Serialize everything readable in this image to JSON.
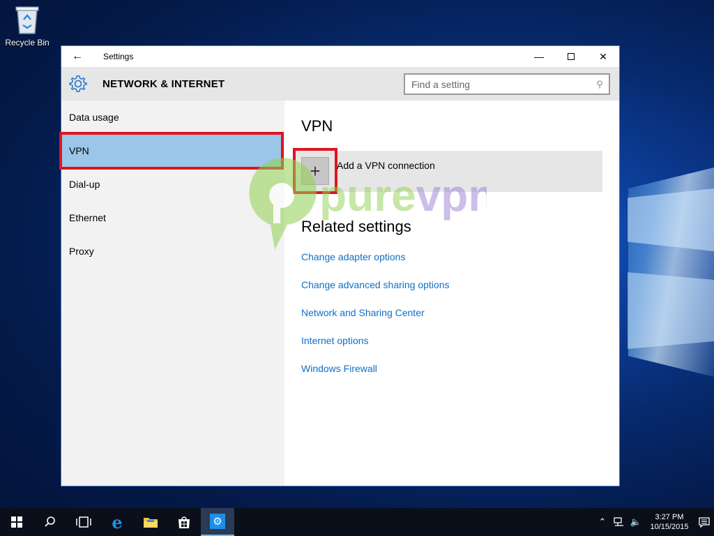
{
  "desktop": {
    "recycle_bin_label": "Recycle Bin"
  },
  "window": {
    "title": "Settings",
    "back_icon": "back-arrow-icon",
    "controls": [
      "minimize",
      "maximize",
      "close"
    ]
  },
  "header": {
    "section_title": "NETWORK & INTERNET",
    "search_placeholder": "Find a setting"
  },
  "sidebar": {
    "items": [
      {
        "label": "Data usage",
        "active": false
      },
      {
        "label": "VPN",
        "active": true
      },
      {
        "label": "Dial-up",
        "active": false
      },
      {
        "label": "Ethernet",
        "active": false
      },
      {
        "label": "Proxy",
        "active": false
      }
    ]
  },
  "main": {
    "heading": "VPN",
    "add_vpn_label": "Add a VPN connection",
    "related_heading": "Related settings",
    "links": [
      "Change adapter options",
      "Change advanced sharing options",
      "Network and Sharing Center",
      "Internet options",
      "Windows Firewall"
    ]
  },
  "watermark": {
    "text": "purevpn"
  },
  "taskbar": {
    "clock_time": "3:27 PM",
    "clock_date": "10/15/2015"
  },
  "colors": {
    "accent": "#0f6fc6",
    "selection": "#99c6e9",
    "highlight_border": "#e0141e",
    "watermark_green": "#8fd14f",
    "watermark_purple": "#9b7fd6"
  }
}
